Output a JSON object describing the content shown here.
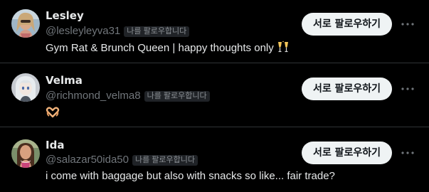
{
  "follow_suggestions": [
    {
      "name": "Lesley",
      "handle": "@lesleyleyva31",
      "follows_you_badge": "나를 팔로우합니다",
      "bio": "Gym Rat & Brunch Queen | happy thoughts only",
      "bio_emoji_icon": "clinking-glasses-icon",
      "follow_back_label": "서로 팔로우하기",
      "more_icon": "more-horizontal-icon"
    },
    {
      "name": "Velma",
      "handle": "@richmond_velma8",
      "follows_you_badge": "나를 팔로우합니다",
      "bio": "",
      "bio_emoji_icon": "heart-hands-icon",
      "follow_back_label": "서로 팔로우하기",
      "more_icon": "more-horizontal-icon"
    },
    {
      "name": "Ida",
      "handle": "@salazar50ida50",
      "follows_you_badge": "나를 팔로우합니다",
      "bio": "i come with baggage but also with snacks so like... fair trade?",
      "follow_back_label": "서로 팔로우하기",
      "more_icon": "more-horizontal-icon"
    }
  ],
  "colors": {
    "background": "#000000",
    "primary_text": "#e7e9ea",
    "secondary_text": "#71767b",
    "badge_background": "#202327",
    "button_background": "#eff3f4",
    "button_text": "#0f1419",
    "divider": "#2f3336"
  }
}
